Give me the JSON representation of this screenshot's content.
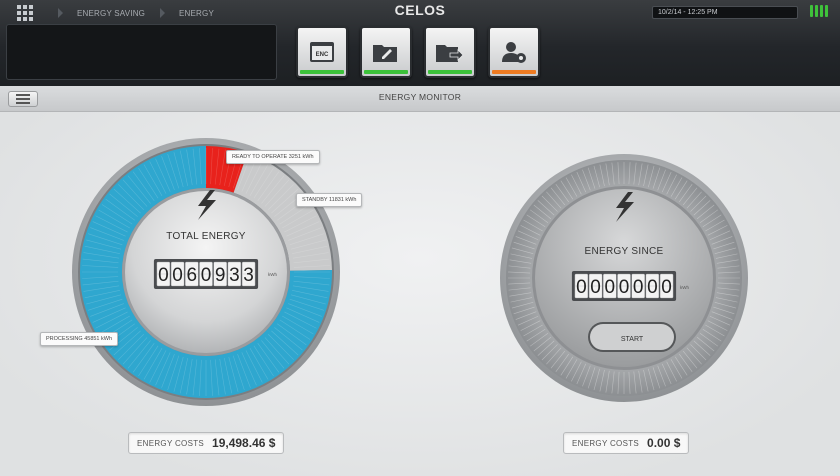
{
  "header": {
    "app_title": "CELOS",
    "breadcrumbs": [
      "ENERGY SAVING",
      "ENERGY"
    ],
    "datetime": "10/2/14 - 12:25 PM",
    "app_tiles": [
      {
        "icon": "enc-window-icon",
        "label": "ENC",
        "status": "green"
      },
      {
        "icon": "folder-edit-icon",
        "status": "green"
      },
      {
        "icon": "folder-export-icon",
        "status": "green"
      },
      {
        "icon": "user-settings-icon",
        "status": "orange"
      }
    ]
  },
  "subbar": {
    "title": "ENERGY MONITOR"
  },
  "total_gauge": {
    "title": "TOTAL ENERGY",
    "counter": "0060933",
    "unit": "kWh",
    "callouts": {
      "ready": "READY TO OPERATE 3251 kWh",
      "standby": "STANDBY 11831 kWh",
      "processing": "PROCESSING 45851 kWh"
    },
    "segments": [
      {
        "name": "ready to operate",
        "kwh": 3251,
        "color": "#e8221c"
      },
      {
        "name": "standby",
        "kwh": 11831,
        "color": "#c9cacb"
      },
      {
        "name": "processing",
        "kwh": 45851,
        "color": "#2fa7cf"
      }
    ]
  },
  "since_gauge": {
    "title": "ENERGY SINCE",
    "counter": "0000000",
    "unit": "kWh",
    "start_label": "START"
  },
  "costs": {
    "total_label": "ENERGY COSTS",
    "total_value": "19,498.46 $",
    "since_label": "ENERGY COSTS",
    "since_value": "0.00 $"
  },
  "colors": {
    "accent_green": "#3cc13a",
    "accent_orange": "#ee7b22",
    "processing_blue": "#2fa7cf",
    "ready_red": "#e8221c"
  }
}
